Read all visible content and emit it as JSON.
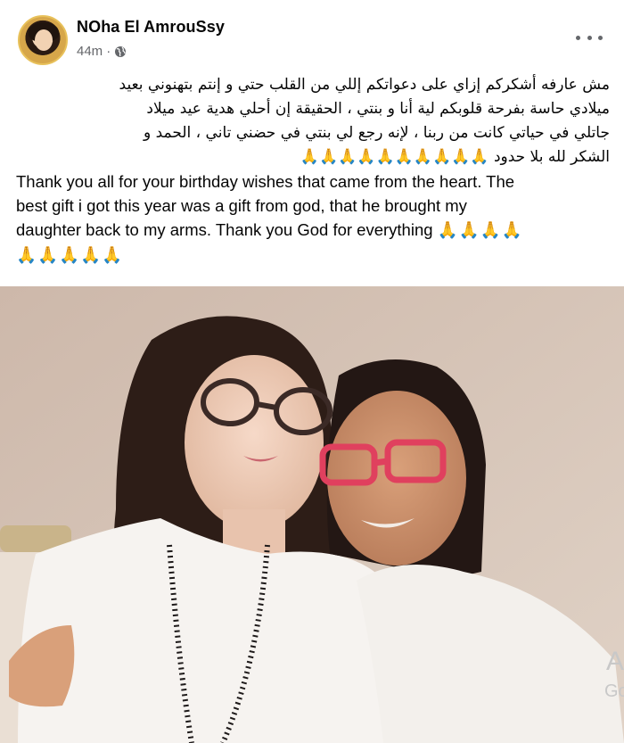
{
  "post": {
    "author": "NOha El AmrouSsy",
    "timestamp": "44m",
    "separator": "·",
    "arabic_lines": [
      "مش عارفه أشكركم إزاي على دعواتكم إللي من القلب حتي و إنتم بتهنوني بعيد",
      "ميلادي حاسة بفرحة قلوبكم لية أنا و بنتي ، الحقيقة إن أحلي هدية عيد ميلاد",
      "جاتلي في حياتي كانت من ربنا ، لإنه رجع لي بنتي في حضني تاني ، الحمد و",
      "الشكر لله بلا حدود"
    ],
    "arabic_emoji": "🙏🙏🙏🙏🙏🙏🙏🙏🙏🙏",
    "english_lines": [
      "Thank you all for your birthday wishes that came from the heart. The",
      "best gift i got this year was a gift from god, that he brought my",
      "daughter back to my arms. Thank you God for everything"
    ],
    "english_emoji_inline": "🙏🙏🙏🙏",
    "english_emoji_line": "🙏🙏🙏🙏🙏",
    "watermark_letters": [
      "A",
      "Go"
    ]
  },
  "icons": {
    "globe": "globe-icon",
    "more": "more-options-icon",
    "pray": "folded-hands-emoji"
  },
  "colors": {
    "text": "#050505",
    "meta": "#65676b",
    "wall": "#d6c3b6",
    "shirt": "#f4f1ee"
  }
}
